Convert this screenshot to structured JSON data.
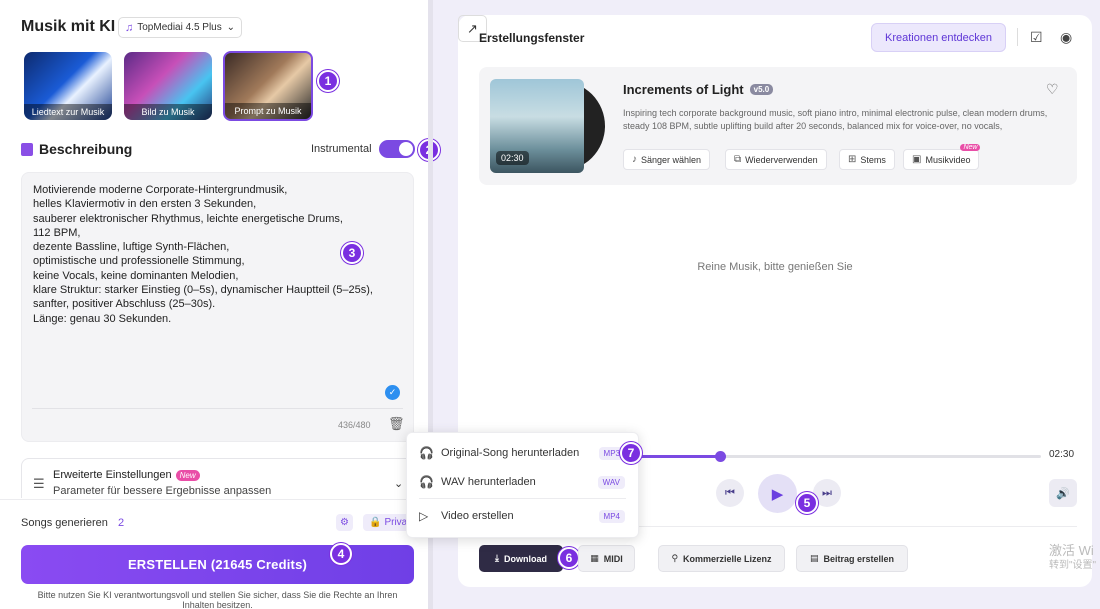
{
  "left": {
    "app_title": "Musik mit KI",
    "model_select": {
      "value": "TopMediai 4.5 Plus",
      "icon": "music-note-icon"
    },
    "modes": [
      {
        "label": "Liedtext zur Musik"
      },
      {
        "label": "Bild zu Musik"
      },
      {
        "label": "Prompt zu Musik",
        "selected": true
      }
    ],
    "description": {
      "title": "Beschreibung",
      "instrumental_label": "Instrumental",
      "instrumental_on": true,
      "prompt_text": "Motivierende moderne Corporate-Hintergrundmusik,\nhelles Klaviermotiv in den ersten 3 Sekunden,\nsauberer elektronischer Rhythmus, leichte energetische Drums,\n112 BPM,\ndezente Bassline, luftige Synth-Flächen,\noptimistische und professionelle Stimmung,\nkeine Vocals, keine dominanten Melodien,\nklare Struktur: starker Einstieg (0–5s), dynamischer Hauptteil (5–25s),\nsanfter, positiver Abschluss (25–30s).\nLänge: genau 30 Sekunden.",
      "char_count": "436/480"
    },
    "advanced": {
      "title": "Erweiterte Einstellungen",
      "new_label": "New",
      "subtitle": "Parameter für bessere Ergebnisse anpassen"
    },
    "songs": {
      "label": "Songs generieren",
      "count": "2",
      "privacy_label": "Privat"
    },
    "create_button": "ERSTELLEN (21645 Credits)",
    "disclaimer": "Bitte nutzen Sie KI verantwortungsvoll und stellen Sie sicher, dass Sie die Rechte an Ihren Inhalten besitzen."
  },
  "right": {
    "panel_title": "Erstellungsfenster",
    "explore_button": "Kreationen entdecken",
    "song": {
      "title": "Increments of Light",
      "version": "v5.0",
      "duration": "02:30",
      "description": "Inspiring tech corporate background music, soft piano intro, minimal electronic pulse, clean modern drums, steady 108 BPM, subtle uplifting build after 20 seconds, balanced mix for voice-over, no vocals,",
      "actions": [
        "Sänger wählen",
        "Wiederverwenden",
        "Stems",
        "Musikvideo"
      ],
      "new_tag": "New"
    },
    "empty_text": "Reine Musik, bitte genießen Sie",
    "player": {
      "progress": 0.22,
      "time_end": "02:30"
    },
    "bottom_buttons": {
      "download": "Download",
      "midi": "MIDI",
      "license": "Kommerzielle Lizenz",
      "post": "Beitrag erstellen"
    },
    "download_menu": [
      {
        "label": "Original-Song herunterladen",
        "format": "MP3"
      },
      {
        "label": "WAV herunterladen",
        "format": "WAV"
      },
      {
        "label": "Video erstellen",
        "format": "MP4"
      }
    ]
  },
  "watermark": {
    "line1": "激活 Wi",
    "line2": "转到\"设置\""
  },
  "colors": {
    "accent": "#7b4ae2",
    "badge": "#7a2fe0",
    "download_dark": "#2f2b45"
  },
  "badges": [
    "1",
    "2",
    "3",
    "4",
    "5",
    "6",
    "7"
  ]
}
